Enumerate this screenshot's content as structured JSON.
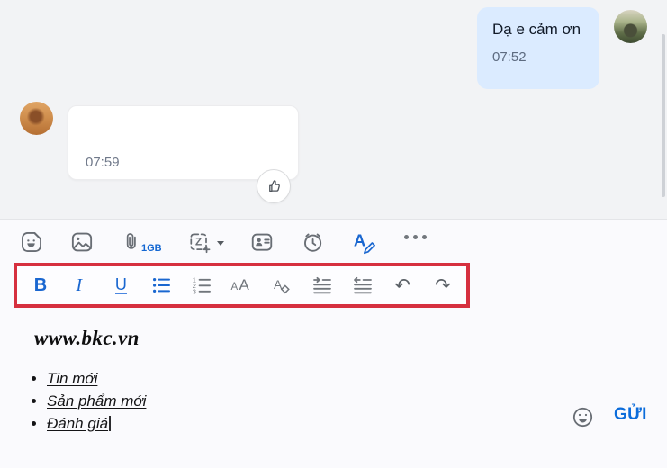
{
  "chat": {
    "outgoing": {
      "text": "Dạ e cảm ơn",
      "time": "07:52"
    },
    "incoming": {
      "time": "07:59"
    }
  },
  "toolbar": {
    "attachment_limit": "1GB",
    "capture_letter": "Z",
    "format_letter": "A"
  },
  "format_bar": {
    "bold": "B",
    "italic": "I",
    "underline": "U",
    "digits": [
      "1",
      "2",
      "3"
    ],
    "size_small": "A",
    "size_large": "A",
    "color_letter": "A",
    "undo": "↶",
    "redo": "↷"
  },
  "editor": {
    "heading": "www.bkc.vn",
    "items": [
      "Tin mới",
      "Sản phẩm mới",
      "Đánh giá"
    ],
    "send": "GỬI"
  },
  "colors": {
    "accent": "#1a67d0",
    "send_blue": "#0b6cdb",
    "highlight_border": "#d6303f",
    "outgoing_bubble": "#dbebff",
    "chat_background": "#f2f3f5"
  }
}
